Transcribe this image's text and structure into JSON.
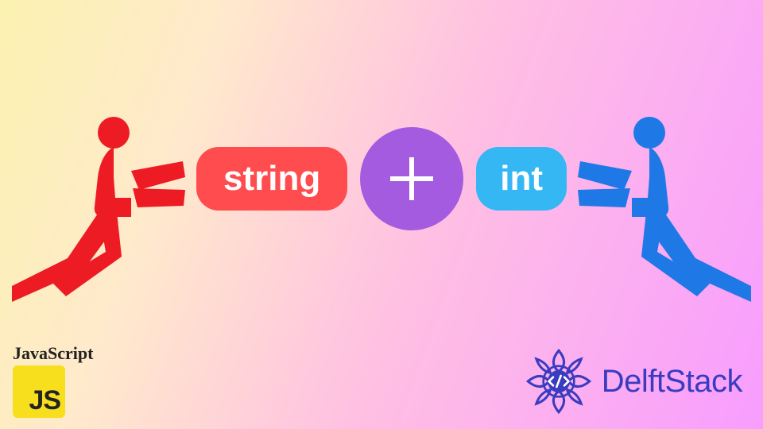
{
  "diagram": {
    "left_pill": "string",
    "operator": "+",
    "right_pill": "int"
  },
  "badges": {
    "js_label": "JavaScript",
    "js_logo_text": "JS",
    "delft_text": "DelftStack"
  },
  "colors": {
    "pill_red": "#ff4c4e",
    "pill_blue": "#35b7f4",
    "plus_circle": "#a45be0",
    "figure_red": "#ed1c24",
    "figure_blue": "#1e78e6",
    "js_yellow": "#f7df1e",
    "delft_blue": "#3a3cc0"
  }
}
